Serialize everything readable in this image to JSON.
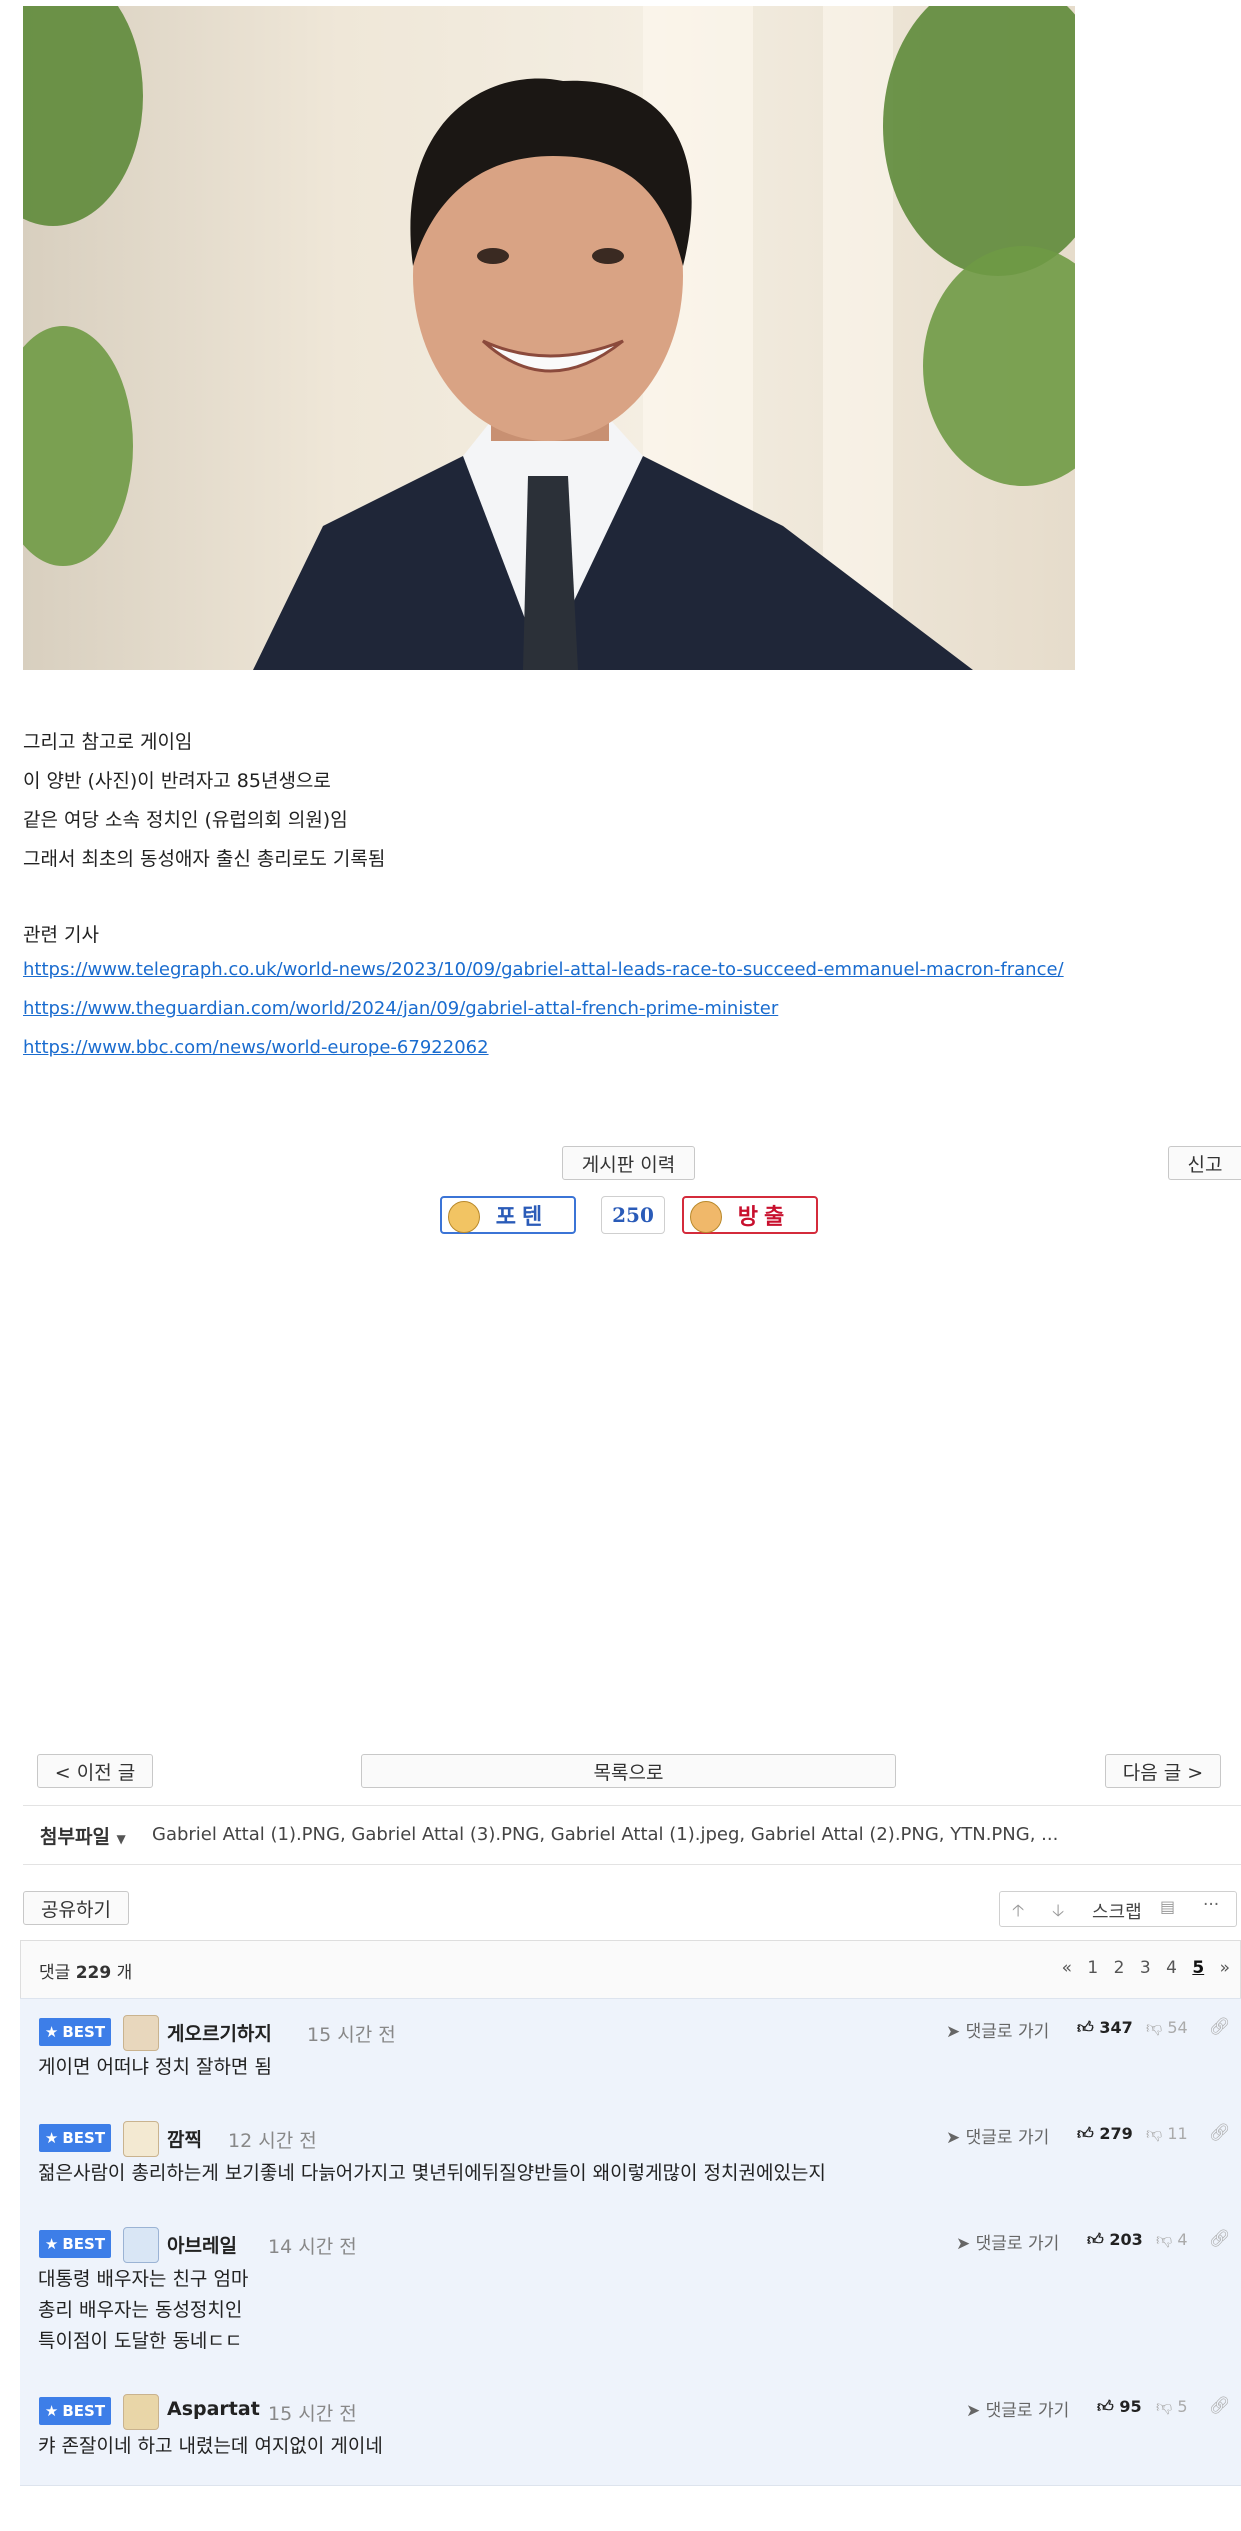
{
  "article": {
    "lines": [
      "그리고 참고로 게이임",
      "이 양반 (사진)이 반려자고 85년생으로",
      "같은 여당 소속 정치인 (유럽의회 의원)임",
      "그래서 최초의 동성애자 출신 총리로도 기록됨"
    ],
    "related_heading": "관련 기사",
    "links": [
      "https://www.telegraph.co.uk/world-news/2023/10/09/gabriel-attal-leads-race-to-succeed-emmanuel-macron-france/",
      "https://www.theguardian.com/world/2024/jan/09/gabriel-attal-french-prime-minister",
      "https://www.bbc.com/news/world-europe-67922062"
    ]
  },
  "actions": {
    "board_history": "게시판 이력",
    "report": "신고",
    "upvote_label": "포텐",
    "vote_count": "250",
    "downvote_label": "방출"
  },
  "nav": {
    "prev": "< 이전 글",
    "list": "목록으로",
    "next": "다음 글 >"
  },
  "attachments": {
    "label": "첨부파일",
    "files": "Gabriel Attal (1).PNG,  Gabriel Attal (3).PNG,  Gabriel Attal (1).jpeg,  Gabriel Attal (2).PNG,  YTN.PNG,  ..."
  },
  "toolbar": {
    "share": "공유하기",
    "scrap": "스크랩",
    "more": "···"
  },
  "comments_header": {
    "prefix": "댓글",
    "count": "229",
    "suffix": "개",
    "pages": [
      "«",
      "1",
      "2",
      "3",
      "4",
      "5",
      "»"
    ],
    "current_page": "5"
  },
  "comments": [
    {
      "badge": "BEST",
      "user": "게오르기하지",
      "time": "15 시간 전",
      "reply": "댓글로 가기",
      "likes": "347",
      "dislikes": "54",
      "text": [
        "게이면 어떠냐 정치 잘하면 됨"
      ]
    },
    {
      "badge": "BEST",
      "user": "깜찍",
      "time": "12 시간 전",
      "reply": "댓글로 가기",
      "likes": "279",
      "dislikes": "11",
      "text": [
        "젊은사람이 총리하는게 보기좋네 다늙어가지고 몇년뒤에뒤질양반들이 왜이렇게많이 정치권에있는지"
      ]
    },
    {
      "badge": "BEST",
      "user": "아브레일",
      "time": "14 시간 전",
      "reply": "댓글로 가기",
      "likes": "203",
      "dislikes": "4",
      "text": [
        "대통령 배우자는 친구 엄마",
        "총리 배우자는 동성정치인",
        "특이점이 도달한 동네ㄷㄷ"
      ]
    },
    {
      "badge": "BEST",
      "user": "Aspartat",
      "time": "15 시간 전",
      "reply": "댓글로 가기",
      "likes": "95",
      "dislikes": "5",
      "text": [
        "캬 존잘이네 하고 내렸는데 여지없이 게이네"
      ]
    }
  ]
}
